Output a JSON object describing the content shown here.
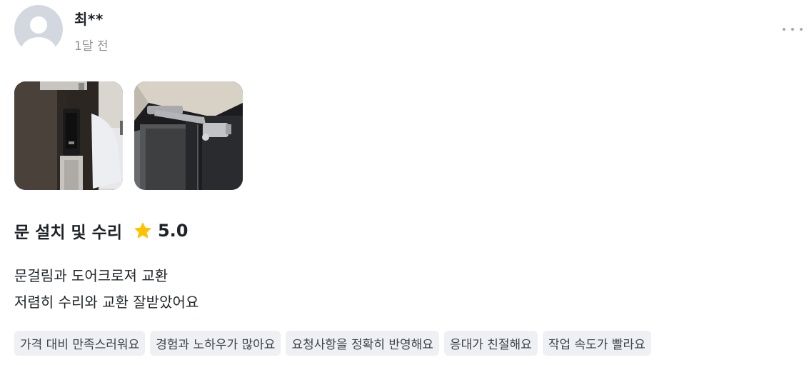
{
  "review": {
    "user_name": "최**",
    "time_ago": "1달 전",
    "service_title": "문 설치 및 수리",
    "rating": "5.0",
    "body_lines": [
      "문걸림과 도어크로져 교환",
      "저렴히 수리와 교환 잘받았어요"
    ],
    "tags": [
      "가격 대비 만족스러워요",
      "경험과 노하우가 많아요",
      "요청사항을 정확히 반영해요",
      "응대가 친절해요",
      "작업 속도가 빨라요"
    ],
    "photos": [
      "door-lock-photo",
      "door-closer-photo"
    ]
  },
  "icons": {
    "avatar": "user-avatar-icon",
    "more": "more-dots-icon",
    "rating": "star-icon"
  },
  "colors": {
    "star": "#ffc100",
    "tag_background": "#eef0f3",
    "muted_text": "#8a9099",
    "avatar": "#d3d8e0"
  }
}
